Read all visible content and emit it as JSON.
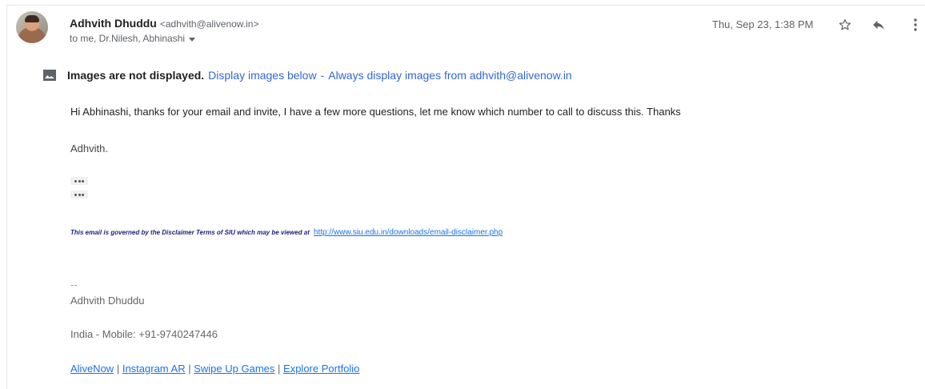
{
  "header": {
    "sender_name": "Adhvith Dhuddu",
    "sender_email": "<adhvith@alivenow.in>",
    "recipients": "to me, Dr.Nilesh, Abhinashi",
    "timestamp": "Thu, Sep 23, 1:38 PM",
    "icons": [
      "star-icon",
      "reply-icon",
      "more-vert-icon",
      "chevron-down-icon",
      "image-icon"
    ]
  },
  "banner": {
    "bold": "Images are not displayed.",
    "display_below": "Display images below",
    "separator": "-",
    "always_display": "Always display images from adhvith@alivenow.in"
  },
  "body": {
    "message": "Hi Abhinashi, thanks for your email and invite, I have a few more questions, let me know which number to call to discuss this. Thanks",
    "signoff": "Adhvith.",
    "disclaimer_text": "This email is governed by the Disclaimer Terms of  SIU which may be viewed at",
    "disclaimer_link": "http://www.siu.edu.in/downloads/email-disclaimer.php"
  },
  "signature": {
    "dash": "--",
    "name": "Adhvith Dhuddu",
    "phone": "India - Mobile: +91-9740247446",
    "links": [
      "AliveNow",
      "Instagram AR",
      "Swipe Up Games",
      "Explore Portfolio"
    ],
    "separator": "|"
  }
}
